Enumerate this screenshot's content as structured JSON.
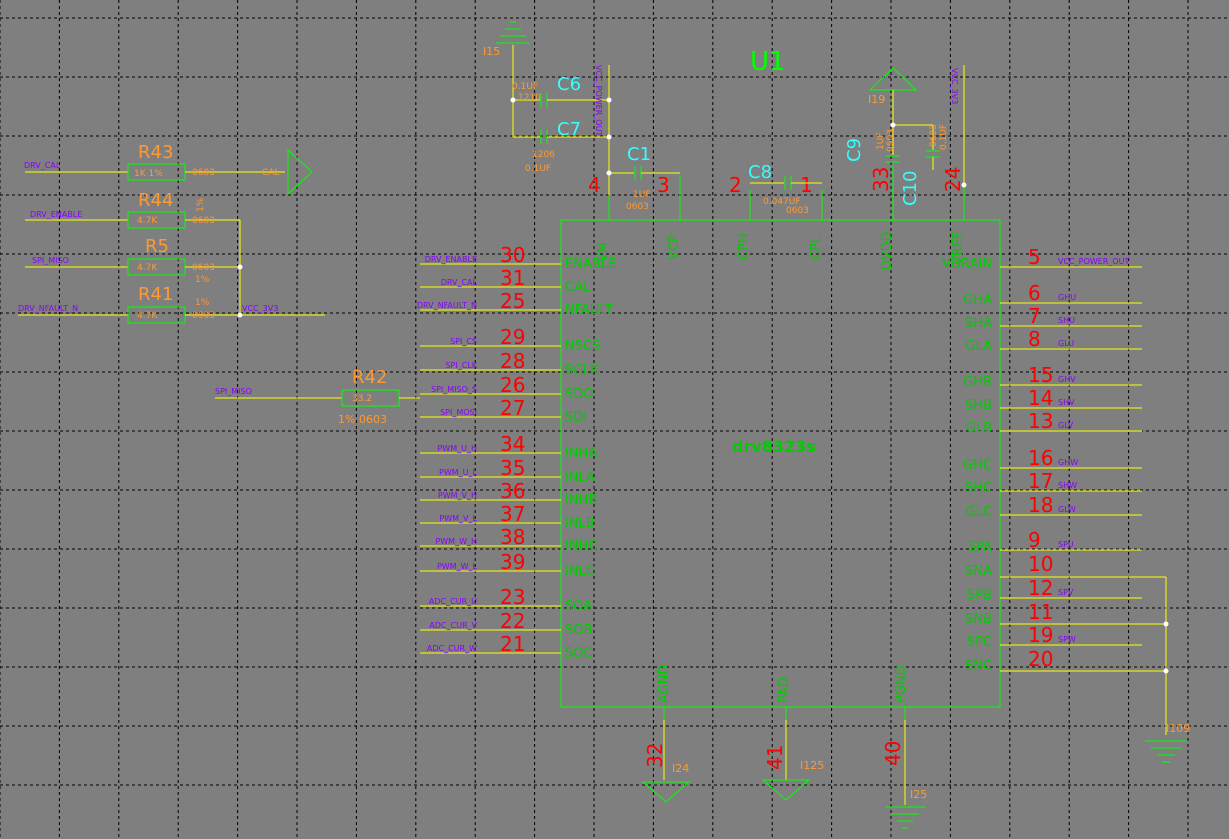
{
  "component": {
    "refdes": "U1",
    "part": "drv8323s",
    "left_pins": [
      {
        "num": "30",
        "name": "ENABLE",
        "net": "DRV_ENABLE"
      },
      {
        "num": "31",
        "name": "CAL",
        "net": "DRV_CAL"
      },
      {
        "num": "25",
        "name": "NFAULT",
        "net": "DRV_NFAULT_N"
      },
      {
        "num": "29",
        "name": "NSCS",
        "net": "SPI_CS"
      },
      {
        "num": "28",
        "name": "SCLK",
        "net": "SPI_CLK"
      },
      {
        "num": "26",
        "name": "SDO",
        "net": "SPI_MISO_S"
      },
      {
        "num": "27",
        "name": "SDI",
        "net": "SPI_MOSI"
      },
      {
        "num": "34",
        "name": "INHA",
        "net": "PWM_U_H"
      },
      {
        "num": "35",
        "name": "INLA",
        "net": "PWM_U_L"
      },
      {
        "num": "36",
        "name": "INHB",
        "net": "PWM_V_H"
      },
      {
        "num": "37",
        "name": "INLB",
        "net": "PWM_V_L"
      },
      {
        "num": "38",
        "name": "INHC",
        "net": "PWM_W_H"
      },
      {
        "num": "39",
        "name": "INLC",
        "net": "PWM_W_L"
      },
      {
        "num": "23",
        "name": "SOA",
        "net": "ADC_CUR_U"
      },
      {
        "num": "22",
        "name": "SOB",
        "net": "ADC_CUR_V"
      },
      {
        "num": "21",
        "name": "SOC",
        "net": "ADC_CUR_W"
      }
    ],
    "right_pins": [
      {
        "num": "5",
        "name": "VDRAIN",
        "net": "VCC_POWER_OUT"
      },
      {
        "num": "6",
        "name": "GHA",
        "net": "GHU"
      },
      {
        "num": "7",
        "name": "SHA",
        "net": "SHU"
      },
      {
        "num": "8",
        "name": "GLA",
        "net": "GLU"
      },
      {
        "num": "15",
        "name": "GHB",
        "net": "GHV"
      },
      {
        "num": "14",
        "name": "SHB",
        "net": "SHV"
      },
      {
        "num": "13",
        "name": "GLB",
        "net": "GLV"
      },
      {
        "num": "16",
        "name": "GHC",
        "net": "GHW"
      },
      {
        "num": "17",
        "name": "SHC",
        "net": "SHW"
      },
      {
        "num": "18",
        "name": "GLC",
        "net": "GLW"
      },
      {
        "num": "9",
        "name": "SPA",
        "net": "SPU"
      },
      {
        "num": "10",
        "name": "SNA",
        "net": ""
      },
      {
        "num": "12",
        "name": "SPB",
        "net": "SPV"
      },
      {
        "num": "11",
        "name": "SNB",
        "net": ""
      },
      {
        "num": "19",
        "name": "SPC",
        "net": "SPW"
      },
      {
        "num": "20",
        "name": "SNC",
        "net": ""
      }
    ],
    "top_pins": [
      {
        "num": "4",
        "name": "VM"
      },
      {
        "num": "3",
        "name": "VCP"
      },
      {
        "num": "2",
        "name": "CPH"
      },
      {
        "num": "1",
        "name": "CPL"
      },
      {
        "num": "33",
        "name": "DVDD"
      },
      {
        "num": "24",
        "name": "VREF"
      }
    ],
    "bottom_pins": [
      {
        "num": "32",
        "name": "AGND",
        "inst": "I24"
      },
      {
        "num": "41",
        "name": "PAD",
        "inst": "I125"
      },
      {
        "num": "40",
        "name": "PGND",
        "inst": "I25"
      }
    ]
  },
  "resistors": [
    {
      "ref": "R43",
      "value": "1K 1%",
      "pkg": "0603",
      "net_in": "DRV_CAL",
      "net_out": "CAL"
    },
    {
      "ref": "R44",
      "value": "4.7K",
      "pkg": "0603",
      "net_in": "DRV_ENABLE",
      "extra": "1%"
    },
    {
      "ref": "R5",
      "value": "4.7K",
      "pkg": "0603",
      "net_in": "SPI_MISO",
      "extra": "1%"
    },
    {
      "ref": "R41",
      "value": "4.7K",
      "pkg": "0603",
      "net_in": "DRV_NFAULT_N",
      "extra": "1%",
      "net_out": "VCC_3V3"
    },
    {
      "ref": "R42",
      "value": "33.2",
      "pkg": "1%  0603",
      "net_in": "SPI_MISO"
    }
  ],
  "capacitors": [
    {
      "ref": "C6",
      "value": "0.1UF",
      "pkg": "1210"
    },
    {
      "ref": "C7",
      "value": "0.1UF",
      "pkg": "1206"
    },
    {
      "ref": "C1",
      "value": "1UF",
      "pkg": "0603"
    },
    {
      "ref": "C8",
      "value": "0.047UF",
      "pkg": "0603"
    },
    {
      "ref": "C9",
      "value": "1UF",
      "pkg": "0603"
    },
    {
      "ref": "C10",
      "value": "0.1UF",
      "pkg": "0603"
    }
  ],
  "supply": {
    "top_ground": "I15",
    "vm_net": "VCC_POWER_OUT",
    "dvdd_sym": "I19",
    "vref_net": "VCC_3V3",
    "gnd_right": "I109"
  },
  "colors": {
    "background": "#7f7f7f",
    "wire": "#00ff00",
    "wire_alt": "#ffff00",
    "pin_number": "#ff0000",
    "refdes": "#ff9933",
    "cap_refdes": "#33ffff",
    "net_label": "#8a00ff",
    "grid": "#000000"
  }
}
